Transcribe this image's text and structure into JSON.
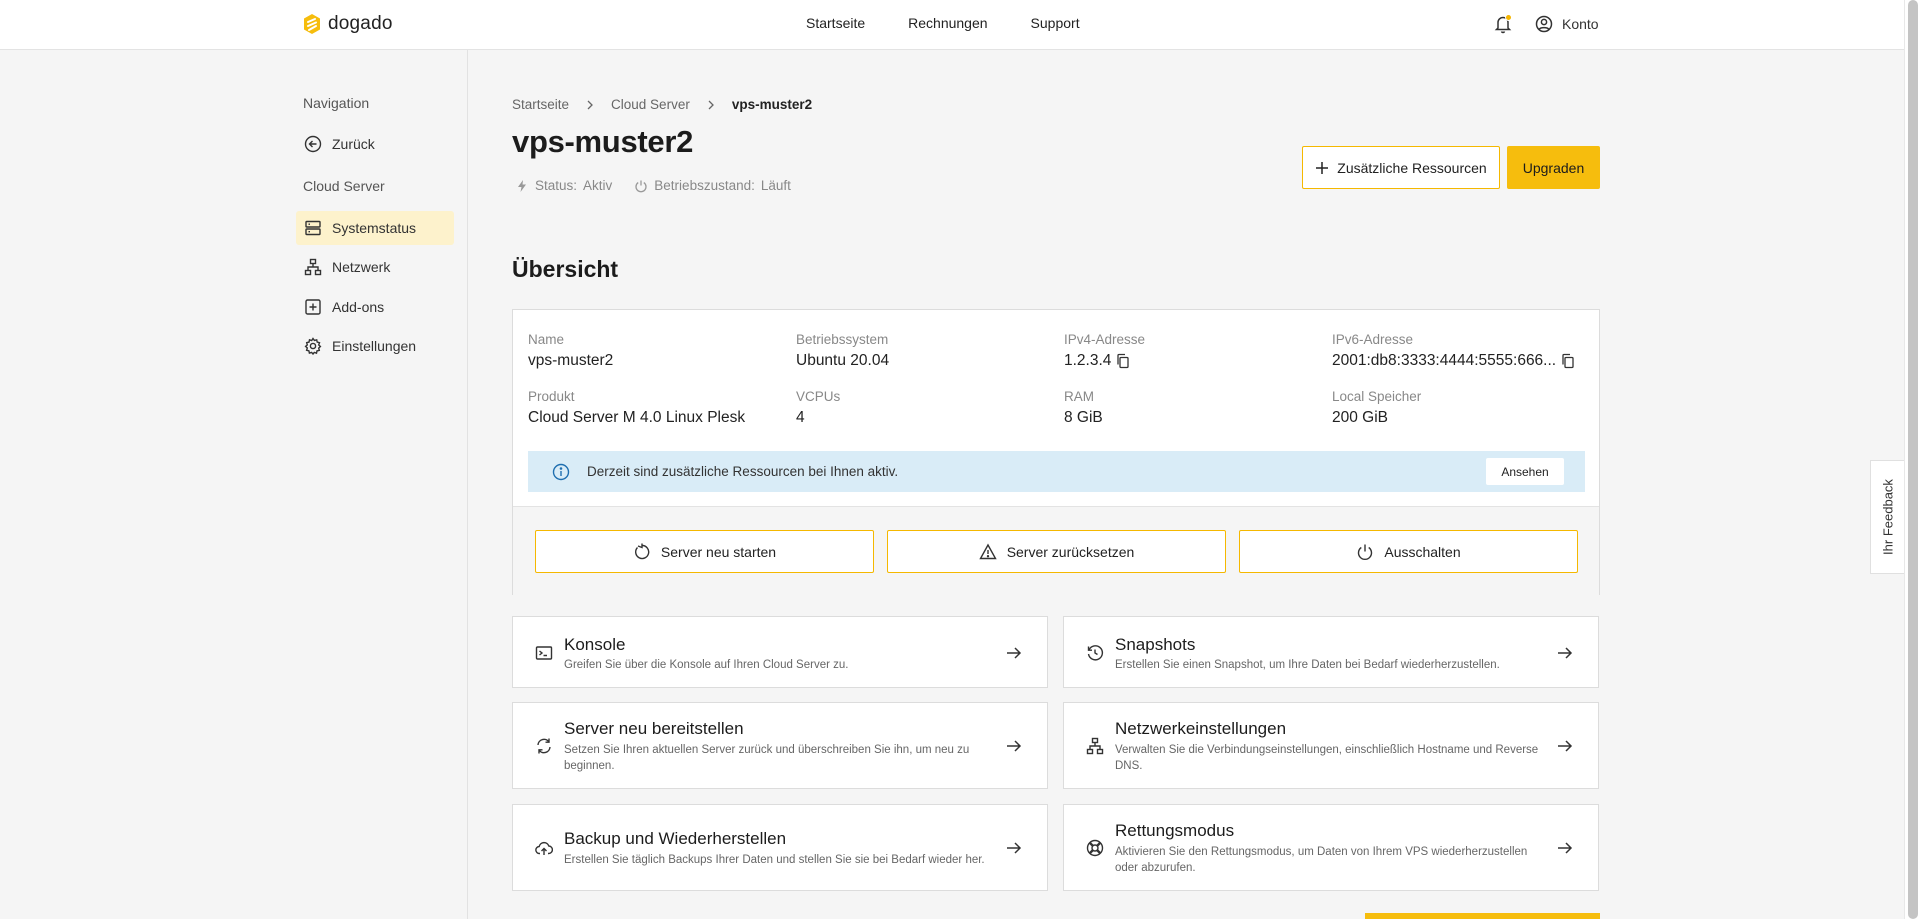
{
  "brand": {
    "name": "dogado",
    "accent": "#f6bd0d"
  },
  "topnav": {
    "items": [
      "Startseite",
      "Rechnungen",
      "Support"
    ],
    "account": "Konto"
  },
  "sidebar": {
    "heading_nav": "Navigation",
    "back": "Zurück",
    "heading_section": "Cloud Server",
    "items": [
      {
        "label": "Systemstatus",
        "icon": "server-icon",
        "active": true
      },
      {
        "label": "Netzwerk",
        "icon": "network-icon"
      },
      {
        "label": "Add-ons",
        "icon": "plus-square-icon"
      },
      {
        "label": "Einstellungen",
        "icon": "gear-icon"
      }
    ]
  },
  "breadcrumb": [
    "Startseite",
    "Cloud Server",
    "vps-muster2"
  ],
  "page": {
    "title": "vps-muster2",
    "status_label": "Status:",
    "status_value": "Aktiv",
    "state_label": "Betriebszustand:",
    "state_value": "Läuft",
    "btn_resources": "Zusätzliche Ressourcen",
    "btn_upgrade": "Upgraden"
  },
  "overview": {
    "title": "Übersicht",
    "fields": [
      {
        "label": "Name",
        "value": "vps-muster2"
      },
      {
        "label": "Betriebssystem",
        "value": "Ubuntu 20.04"
      },
      {
        "label": "IPv4-Adresse",
        "value": "1.2.3.4"
      },
      {
        "label": "IPv6-Adresse",
        "value": "2001:db8:3333:4444:5555:666..."
      },
      {
        "label": "Produkt",
        "value": "Cloud Server M 4.0 Linux Plesk"
      },
      {
        "label": "VCPUs",
        "value": "4"
      },
      {
        "label": "RAM",
        "value": "8 GiB"
      },
      {
        "label": "Local Speicher",
        "value": "200 GiB"
      }
    ],
    "info_text": "Derzeit sind zusätzliche Ressourcen bei Ihnen aktiv.",
    "info_button": "Ansehen",
    "actions": [
      "Server neu starten",
      "Server zurücksetzen",
      "Ausschalten"
    ]
  },
  "cards": [
    {
      "title": "Konsole",
      "desc": "Greifen Sie über die Konsole auf Ihren Cloud Server zu."
    },
    {
      "title": "Snapshots",
      "desc": "Erstellen Sie einen Snapshot, um Ihre Daten bei Bedarf wiederherzustellen."
    },
    {
      "title": "Server neu bereitstellen",
      "desc": "Setzen Sie Ihren aktuellen Server zurück und überschreiben Sie ihn, um neu zu beginnen."
    },
    {
      "title": "Netzwerkeinstellungen",
      "desc": "Verwalten Sie die Verbindungseinstellungen, einschließlich Hostname und Reverse DNS."
    },
    {
      "title": "Backup und Wiederherstellen",
      "desc": "Erstellen Sie täglich Backups Ihrer Daten und stellen Sie sie bei Bedarf wieder her."
    },
    {
      "title": "Rettungsmodus",
      "desc": "Aktivieren Sie den Rettungsmodus, um Daten von Ihrem VPS wiederherzustellen oder abzurufen."
    }
  ],
  "feedback": "Ihr Feedback"
}
